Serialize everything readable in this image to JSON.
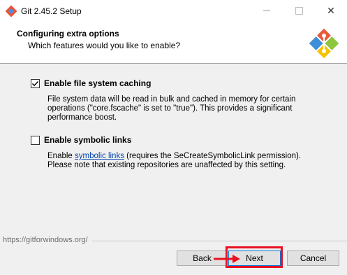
{
  "window": {
    "title": "Git 2.45.2 Setup"
  },
  "header": {
    "title": "Configuring extra options",
    "subtitle": "Which features would you like to enable?"
  },
  "options": [
    {
      "label": "Enable file system caching",
      "checked": true,
      "desc_lines": [
        "File system data will be read in bulk and cached in memory for certain",
        "operations (\"core.fscache\" is set to \"true\"). This provides a significant",
        "performance boost."
      ]
    },
    {
      "label": "Enable symbolic links",
      "checked": false,
      "desc_pre": "Enable ",
      "desc_link": "symbolic links",
      "desc_post": " (requires the SeCreateSymbolicLink permission).",
      "desc_line2": "Please note that existing repositories are unaffected by this setting."
    }
  ],
  "footer": {
    "url": "https://gitforwindows.org/"
  },
  "buttons": {
    "back": "Back",
    "next": "Next",
    "cancel": "Cancel"
  },
  "colors": {
    "highlight": "#e81123",
    "link": "#0645ad",
    "focus_border": "#0078d7"
  }
}
